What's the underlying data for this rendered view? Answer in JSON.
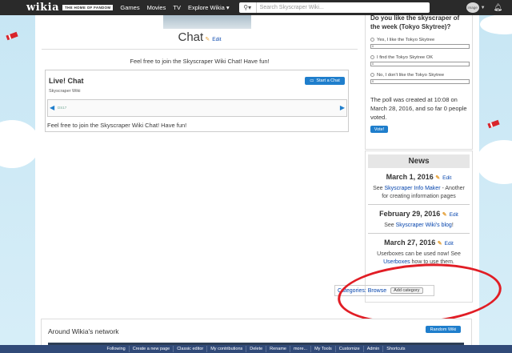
{
  "topbar": {
    "logo": "wikia",
    "tagline": "THE HOME OF FANDOM",
    "nav": [
      "Games",
      "Movies",
      "TV",
      "Explore Wikia ▾"
    ],
    "search_placeholder": "Search Skyscraper Wiki...",
    "avatar_text": "image"
  },
  "chat": {
    "title": "Chat",
    "edit": "Edit",
    "intro": "Feel free to join the Skyscraper Wiki Chat! Have fun!",
    "box_title": "Live! Chat",
    "box_wiki": "Skyscraper Wiki",
    "start_button": "Start a Chat",
    "user": "DS17",
    "footer": "Feel free to join the Skyscraper Wiki Chat! Have fun!"
  },
  "poll": {
    "question": "Do you like the skyscraper of the week (Tokyo Skytree)?",
    "options": [
      {
        "label": "Yes, I like the Tokyo Skytree",
        "count": "0"
      },
      {
        "label": "I find the Tokyo Skytree OK",
        "count": "0"
      },
      {
        "label": "No, I don't like the Tokyo Skytree",
        "count": "0"
      }
    ],
    "info": "The poll was created at 10:08 on March 28, 2016, and so far 0 people voted.",
    "vote_button": "Vote!"
  },
  "news": {
    "title": "News",
    "edit": "Edit",
    "items": [
      {
        "date": "March 1, 2016",
        "pre": "See ",
        "link": "Skyscraper Info Maker",
        "post": " - Another for creating information pages"
      },
      {
        "date": "February 29, 2016",
        "pre": "See ",
        "link": "Skyscraper Wiki's blog",
        "post": "!"
      },
      {
        "date": "March 27, 2016",
        "pre": "Userboxes can be used now! See ",
        "link": "Userboxes",
        "post": " how to use them."
      }
    ]
  },
  "categories": {
    "label": "Categories:",
    "browse": "Browse",
    "add": "Add category"
  },
  "network": {
    "title": "Around Wikia's network",
    "random_button": "Random Wiki"
  },
  "toolbar": [
    "Following",
    "Create a new page",
    "Classic editor",
    "My contributions",
    "Delete",
    "Rename",
    "more...",
    "My Tools",
    "Customize",
    "Admin",
    "Shortcuts"
  ],
  "colors": {
    "accent": "#1f7ecc",
    "toolbar": "#314a78",
    "annotation": "#e11d25"
  }
}
